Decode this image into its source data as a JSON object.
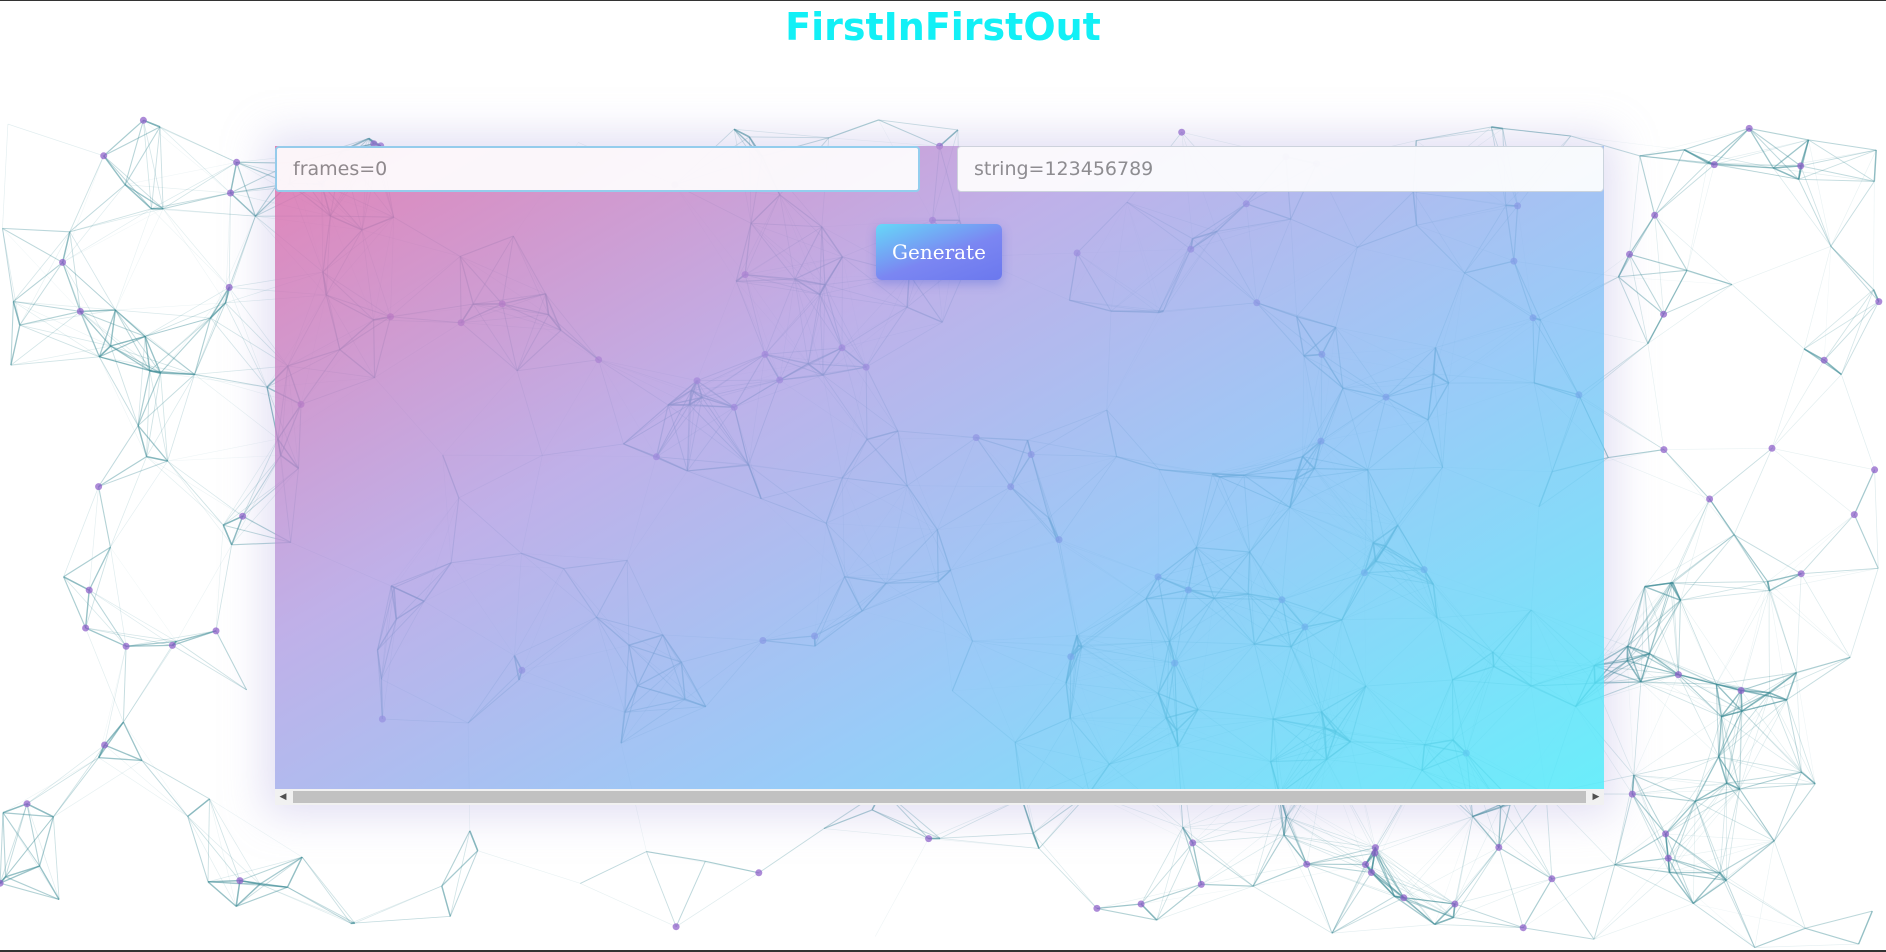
{
  "app": {
    "title": "FirstInFirstOut"
  },
  "inputs": {
    "frames": {
      "placeholder": "frames=0",
      "value": ""
    },
    "string": {
      "placeholder": "string=123456789",
      "value": ""
    }
  },
  "actions": {
    "generate_label": "Generate"
  },
  "scrollbar": {
    "left_arrow": "◀",
    "right_arrow": "▶"
  },
  "theme": {
    "title_color": "#12f0f6",
    "network_line_color": "#3a8a94",
    "network_node_color": "#8a5ac8",
    "gradient_start": "#dc6eaa",
    "gradient_end": "#50ebfa"
  }
}
